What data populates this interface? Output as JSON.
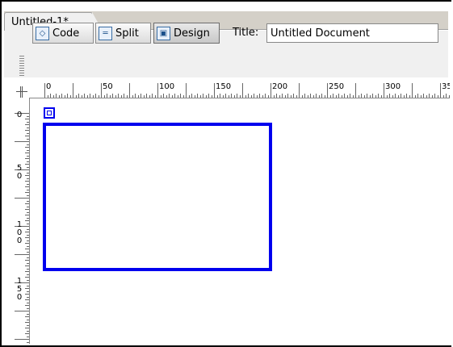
{
  "document_tab": {
    "label": "Untitled-1*"
  },
  "view_buttons": [
    {
      "label": "Code",
      "icon": "code-view-icon",
      "glyph": "◇"
    },
    {
      "label": "Split",
      "icon": "split-view-icon",
      "glyph": "═"
    },
    {
      "label": "Design",
      "icon": "design-view-icon",
      "glyph": "▣"
    }
  ],
  "title_field": {
    "label": "Title:",
    "value": "Untitled Document"
  },
  "horizontal_ruler": {
    "labels": [
      "0",
      "50",
      "100",
      "150",
      "200",
      "250",
      "300",
      "350"
    ]
  },
  "vertical_ruler": {
    "labels": [
      [
        "0"
      ],
      [
        "5",
        "0"
      ],
      [
        "1",
        "0",
        "0"
      ],
      [
        "1",
        "5",
        "0"
      ]
    ]
  },
  "design_canvas": {
    "selection_color": "#0000ee",
    "ruler_color": "#666666"
  }
}
